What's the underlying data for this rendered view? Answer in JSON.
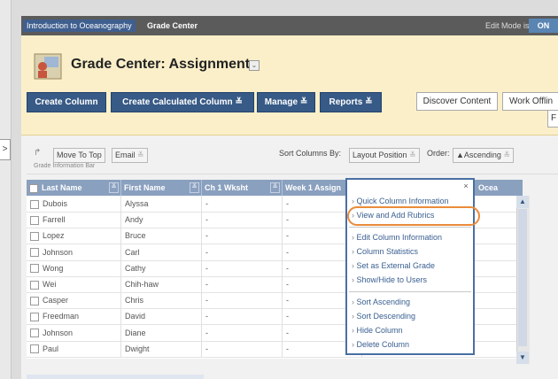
{
  "breadcrumb": {
    "course": "Introduction to Oceanography",
    "page": "Grade Center"
  },
  "edit_mode": {
    "label": "Edit Mode is:",
    "state": "ON"
  },
  "left_tab": ">",
  "page_title": "Grade Center: Assignments",
  "toolbar": {
    "create_column": "Create Column",
    "create_calculated_column": "Create Calculated Column",
    "manage": "Manage",
    "reports": "Reports",
    "discover_content": "Discover Content",
    "work_offline": "Work Offlin",
    "f_btn": "F"
  },
  "grid_toolbar": {
    "move_to_top": "Move To Top",
    "email": "Email",
    "sort_by_label": "Sort Columns By:",
    "sort_by_value": "Layout Position",
    "order_label": "Order:",
    "order_value": "▲Ascending",
    "info_bar": "Grade Information Bar"
  },
  "columns": [
    "Last Name",
    "First Name",
    "Ch 1 Wksht",
    "Week 1 Assign",
    "Ocea"
  ],
  "rows": [
    {
      "last": "Dubois",
      "first": "Alyssa",
      "c1": "-",
      "c2": "-"
    },
    {
      "last": "Farrell",
      "first": "Andy",
      "c1": "-",
      "c2": "-"
    },
    {
      "last": "Lopez",
      "first": "Bruce",
      "c1": "-",
      "c2": "-"
    },
    {
      "last": "Johnson",
      "first": "Carl",
      "c1": "-",
      "c2": "-"
    },
    {
      "last": "Wong",
      "first": "Cathy",
      "c1": "-",
      "c2": "-"
    },
    {
      "last": "Wei",
      "first": "Chih-haw",
      "c1": "-",
      "c2": "-"
    },
    {
      "last": "Casper",
      "first": "Chris",
      "c1": "-",
      "c2": "-"
    },
    {
      "last": "Freedman",
      "first": "David",
      "c1": "-",
      "c2": "-"
    },
    {
      "last": "Johnson",
      "first": "Diane",
      "c1": "-",
      "c2": "-"
    },
    {
      "last": "Paul",
      "first": "Dwight",
      "c1": "-",
      "c2": "-"
    }
  ],
  "popup": {
    "close": "×",
    "groups": [
      [
        "Quick Column Information",
        "View and Add Rubrics"
      ],
      [
        "Edit Column Information",
        "Column Statistics",
        "Set as External Grade",
        "Show/Hide to Users"
      ],
      [
        "Sort Ascending",
        "Sort Descending",
        "Hide Column",
        "Delete Column"
      ]
    ]
  },
  "colors": {
    "toolbar_blue": "#375a86",
    "header_bg": "#fbefc9",
    "grid_header": "#8aa0bf",
    "highlight": "#ea8b3a"
  }
}
